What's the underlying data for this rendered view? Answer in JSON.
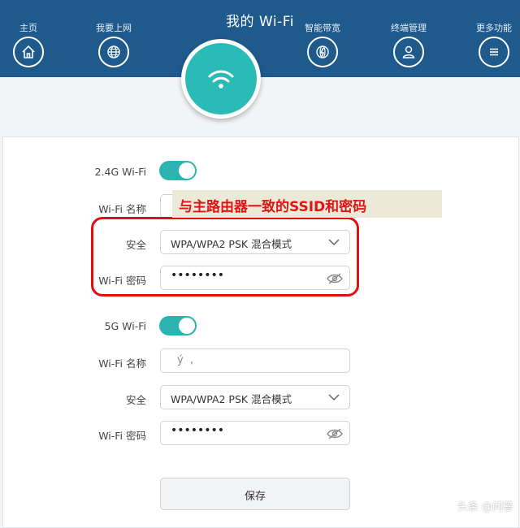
{
  "header": {
    "title": "我的 Wi-Fi",
    "nav": [
      {
        "label": "主页",
        "icon": "home-icon"
      },
      {
        "label": "我要上网",
        "icon": "globe-icon"
      },
      {
        "label": "智能带宽",
        "icon": "bandwidth-globe-icon"
      },
      {
        "label": "终端管理",
        "icon": "user-icon"
      },
      {
        "label": "更多功能",
        "icon": "menu-icon"
      }
    ],
    "center_icon": "wifi-icon"
  },
  "colors": {
    "header_bg": "#1e5a8c",
    "accent_teal": "#2bbbb6",
    "annotation_red": "#e01010",
    "callout_bg": "#ece9d9"
  },
  "annotation": {
    "callout_text": "与主路由器一致的SSID和密码"
  },
  "wifi24": {
    "label": "2.4G Wi-Fi",
    "enabled": true,
    "name_label": "Wi-Fi 名称",
    "name_value": "",
    "security_label": "安全",
    "security_value": "WPA/WPA2 PSK 混合模式",
    "password_label": "Wi-Fi 密码",
    "password_value": "••••••••"
  },
  "wifi5": {
    "label": "5G Wi-Fi",
    "enabled": true,
    "name_label": "Wi-Fi 名称",
    "name_value": "ý ,",
    "security_label": "安全",
    "security_value": "WPA/WPA2 PSK 混合模式",
    "password_label": "Wi-Fi 密码",
    "password_value": "••••••••"
  },
  "save_label": "保存",
  "watermark": "头条 @问答"
}
